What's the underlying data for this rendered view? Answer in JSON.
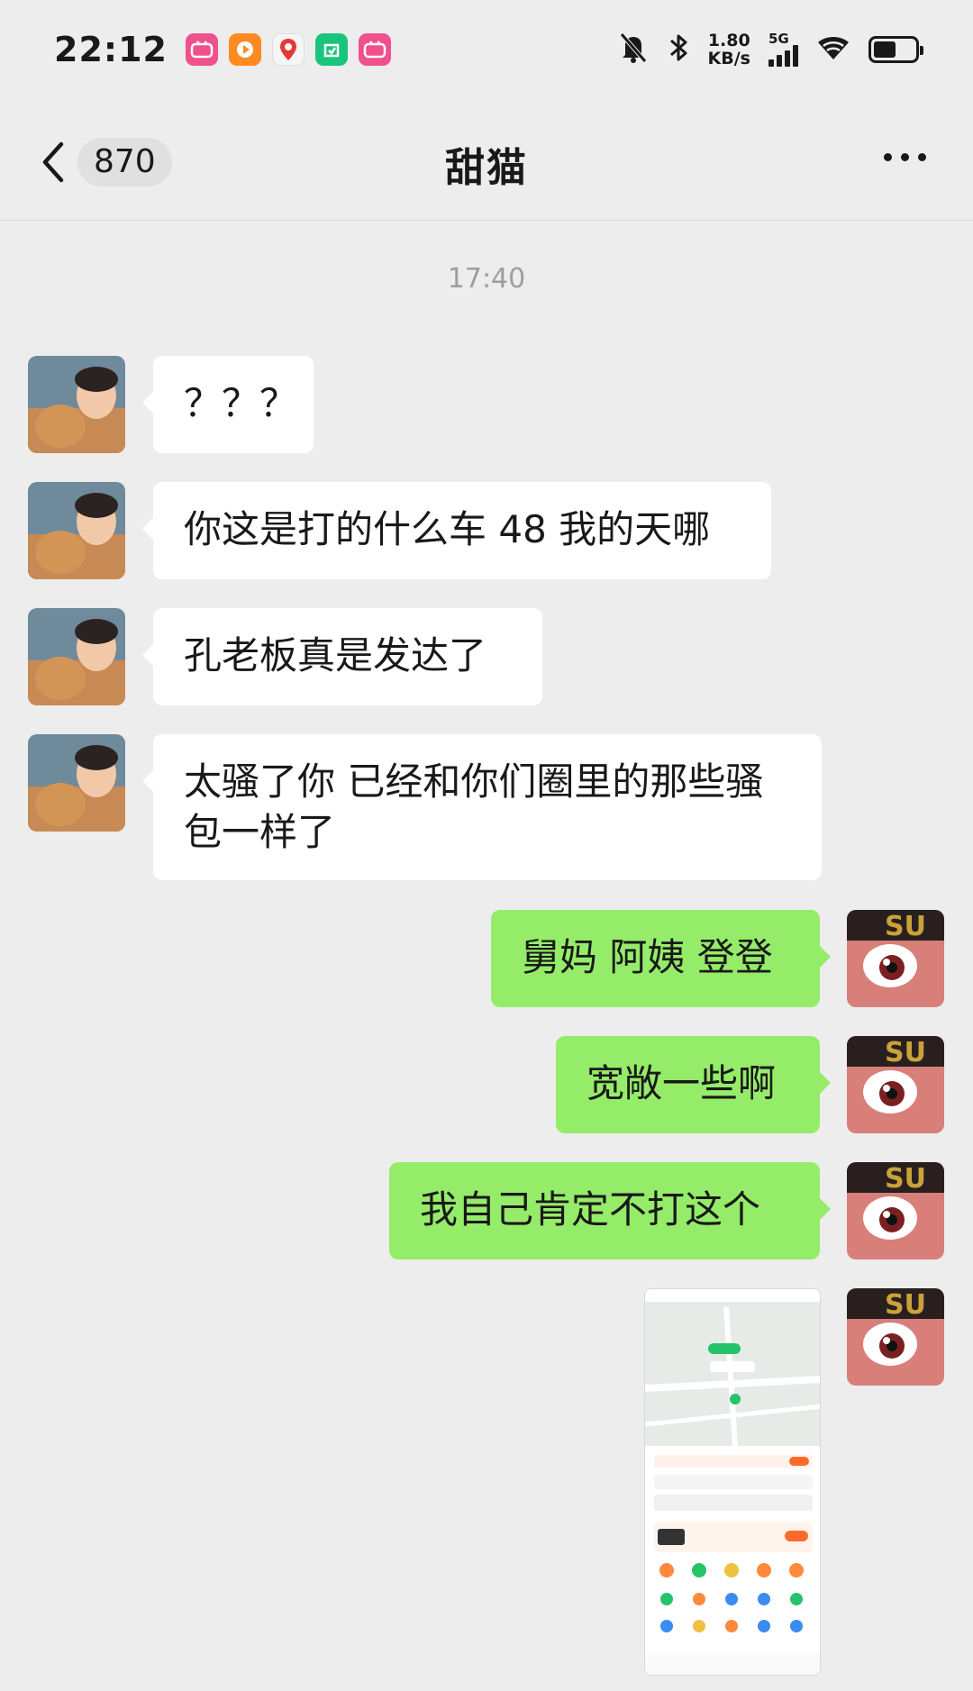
{
  "status_bar": {
    "time": "22:12",
    "net_speed_value": "1.80",
    "net_speed_unit": "KB/s",
    "network_type": "5G",
    "notification_icons": [
      "bilibili-icon",
      "video-app-icon",
      "du-map-icon",
      "mi-home-icon",
      "bilibili-icon"
    ]
  },
  "nav": {
    "unread_count": "870",
    "title": "甜猫"
  },
  "timestamp": "17:40",
  "messages": [
    {
      "side": "in",
      "text": "？？？"
    },
    {
      "side": "in",
      "text": "你这是打的什么车 48 我的天哪"
    },
    {
      "side": "in",
      "text": "孔老板真是发达了"
    },
    {
      "side": "in",
      "text": "太骚了你 已经和你们圈里的那些骚包一样了"
    },
    {
      "side": "out",
      "text": "舅妈 阿姨 登登"
    },
    {
      "side": "out",
      "text": "宽敞一些啊"
    },
    {
      "side": "out",
      "text": "我自己肯定不打这个"
    },
    {
      "side": "out",
      "type": "image",
      "content": "screenshot-thumbnail"
    }
  ],
  "colors": {
    "background": "#ededed",
    "incoming_bubble": "#ffffff",
    "outgoing_bubble": "#95ec69"
  }
}
